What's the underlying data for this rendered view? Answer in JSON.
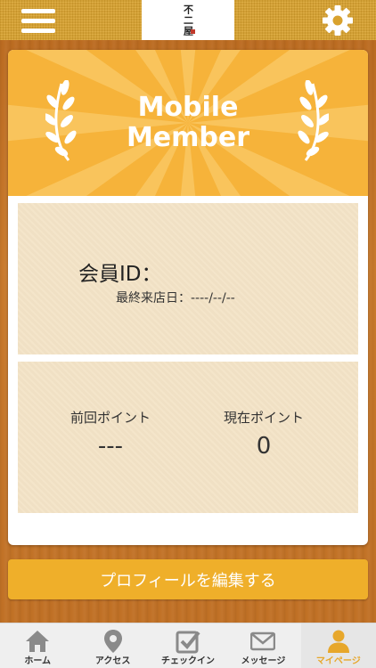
{
  "header": {
    "logo_text": "不二屋",
    "menu_icon": "hamburger-menu-icon",
    "settings_icon": "gear-icon"
  },
  "banner": {
    "title_line1": "Mobile",
    "title_line2": "Member",
    "colors": {
      "base": "#f6b33a",
      "ray": "#f9c45c"
    }
  },
  "member": {
    "id_label": "会員ID：",
    "last_visit": "最終来店日：----/--/--"
  },
  "points": {
    "previous_label": "前回ポイント",
    "previous_value": "---",
    "current_label": "現在ポイント",
    "current_value": "0"
  },
  "edit_profile_label": "プロフィールを編集する",
  "tabs": [
    {
      "label": "ホーム",
      "icon": "home-icon"
    },
    {
      "label": "アクセス",
      "icon": "map-pin-icon"
    },
    {
      "label": "チェックイン",
      "icon": "checkin-icon"
    },
    {
      "label": "メッセージ",
      "icon": "envelope-icon"
    },
    {
      "label": "マイページ",
      "icon": "person-icon",
      "active": true
    }
  ],
  "colors": {
    "accent": "#efaf2a",
    "active_tab": "#e7a72b",
    "panel": "#f3e3c6"
  }
}
